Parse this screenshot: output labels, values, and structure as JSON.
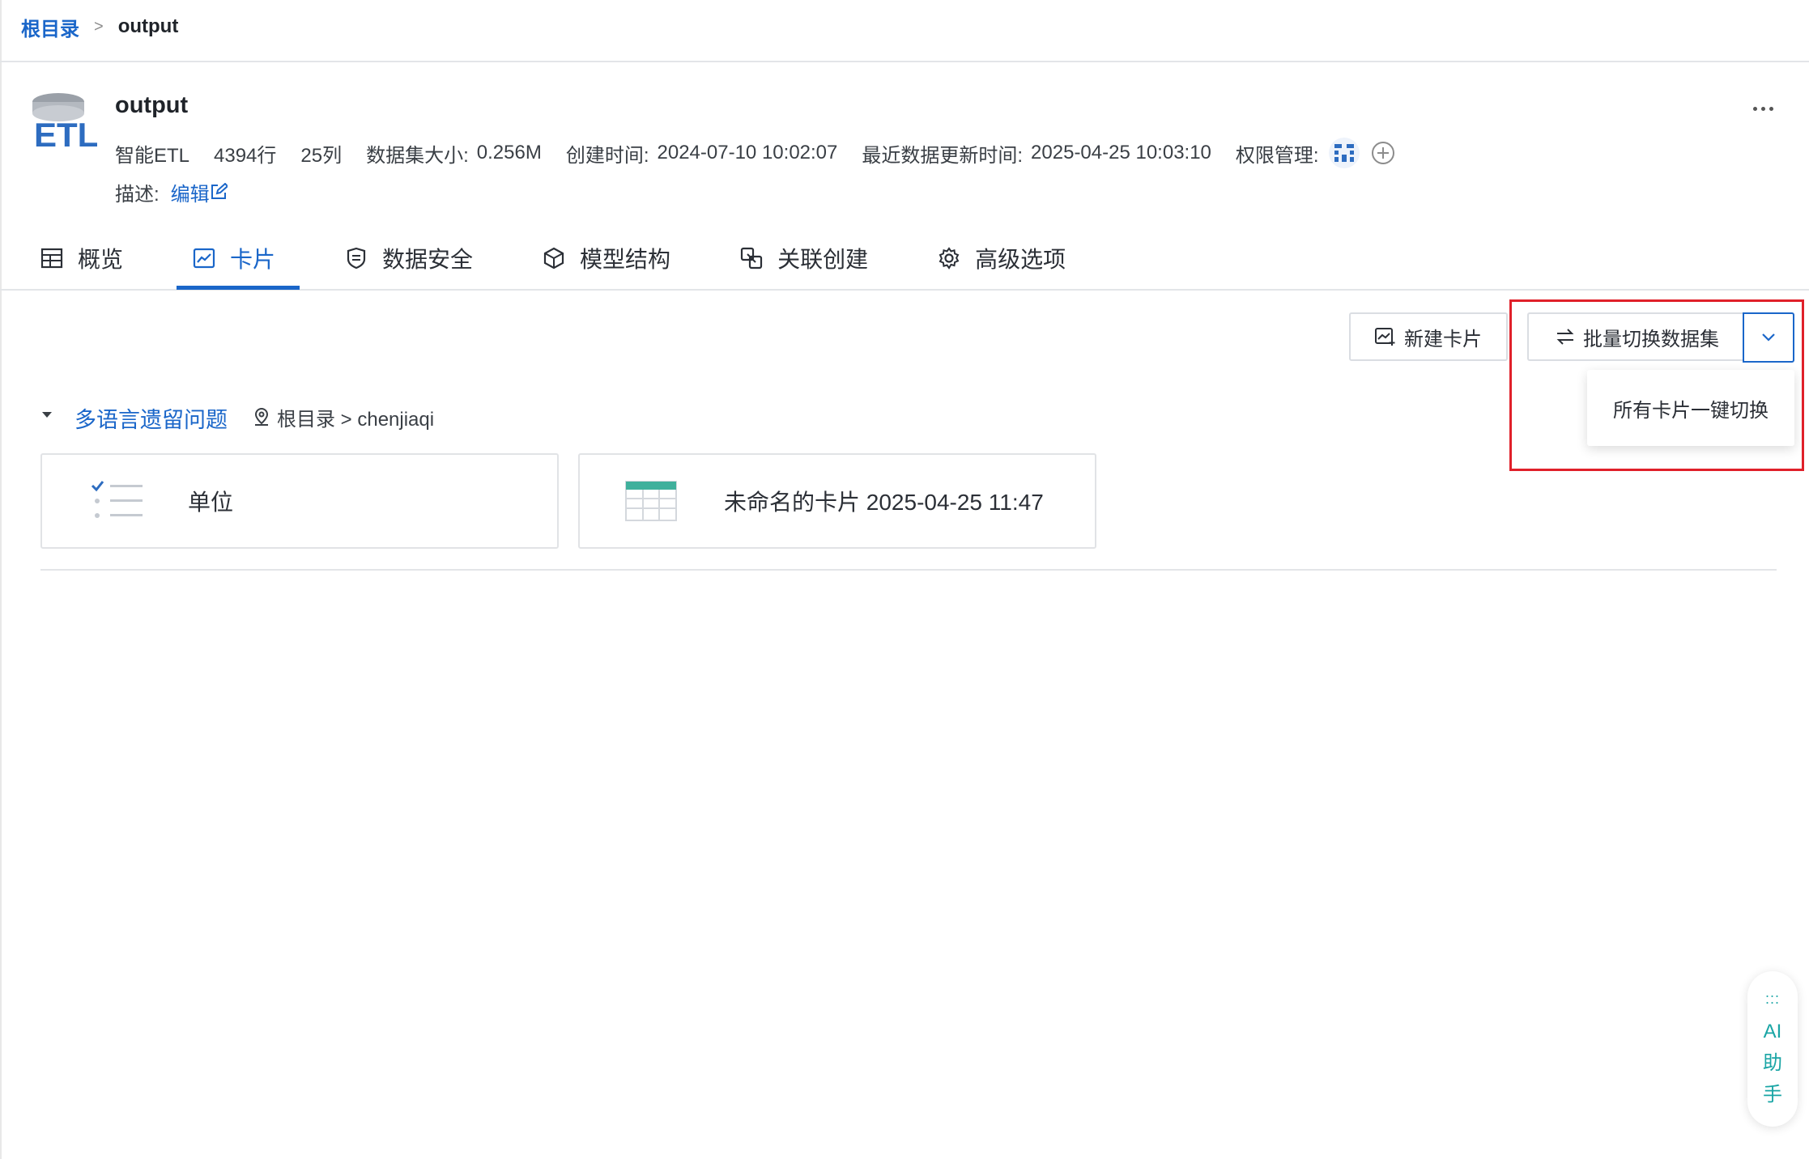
{
  "breadcrumb": {
    "root": "根目录",
    "separator": ">",
    "current": "output"
  },
  "dataset": {
    "icon": "etl-database-icon",
    "title": "output",
    "type": "智能ETL",
    "rows": "4394行",
    "columns": "25列",
    "size_label": "数据集大小:",
    "size_value": "0.256M",
    "created_label": "创建时间:",
    "created_value": "2024-07-10 10:02:07",
    "updated_label": "最近数据更新时间:",
    "updated_value": "2025-04-25 10:03:10",
    "permission_label": "权限管理:",
    "desc_label": "描述:",
    "desc_edit": "编辑"
  },
  "tabs": [
    {
      "label": "概览",
      "icon": "table-icon"
    },
    {
      "label": "卡片",
      "icon": "chart-line-icon",
      "active": true
    },
    {
      "label": "数据安全",
      "icon": "shield-icon"
    },
    {
      "label": "模型结构",
      "icon": "cube-icon"
    },
    {
      "label": "关联创建",
      "icon": "link-icon"
    },
    {
      "label": "高级选项",
      "icon": "gear-icon"
    }
  ],
  "toolbar": {
    "new_card": "新建卡片",
    "batch_switch": "批量切换数据集",
    "dropdown_item": "所有卡片一键切换"
  },
  "group": {
    "title": "多语言遗留问题",
    "location": "根目录 > chenjiaqi"
  },
  "cards": [
    {
      "label": "单位",
      "icon": "checklist-icon"
    },
    {
      "label": "未命名的卡片 2025-04-25 11:47",
      "icon": "table-chart-icon"
    }
  ],
  "assistant": {
    "dots": ":::",
    "chars": [
      "AI",
      "助",
      "手"
    ]
  },
  "colors": {
    "accent": "#1a66c9",
    "highlight": "#e0202a",
    "assistant": "#1aa5a5"
  }
}
